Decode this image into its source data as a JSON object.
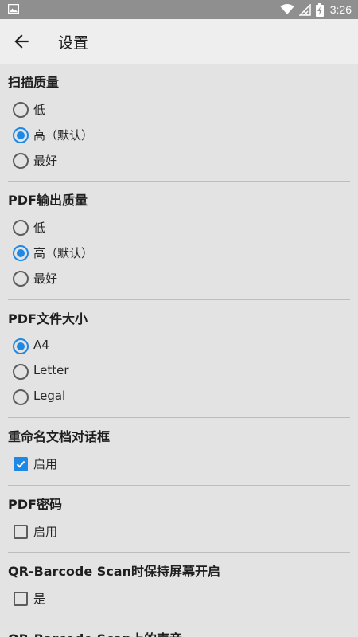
{
  "status_bar": {
    "time": "3:26",
    "icons": [
      "image-icon",
      "wifi-icon",
      "signal-icon",
      "battery-charging-icon"
    ]
  },
  "app_bar": {
    "title": "设置",
    "back_icon": "arrow-left-icon"
  },
  "sections": {
    "scan_quality": {
      "title": "扫描质量",
      "options": [
        "低",
        "高（默认）",
        "最好"
      ],
      "selected": "高（默认）"
    },
    "pdf_quality": {
      "title": "PDF输出质量",
      "options": [
        "低",
        "高（默认）",
        "最好"
      ],
      "selected": "高（默认）"
    },
    "pdf_size": {
      "title": "PDF文件大小",
      "options": [
        "A4",
        "Letter",
        "Legal"
      ],
      "selected": "A4"
    },
    "rename_dialog": {
      "title": "重命名文档对话框",
      "label": "启用",
      "checked": true
    },
    "pdf_password": {
      "title": "PDF密码",
      "label": "启用",
      "checked": false
    },
    "qr_screen_on": {
      "title": "QR-Barcode Scan时保持屏幕开启",
      "label": "是",
      "checked": false
    },
    "qr_sound": {
      "title": "QR-Barcode Scan上的声音"
    }
  },
  "colors": {
    "accent": "#1e88e5",
    "background": "#e3e3e3",
    "status_bar": "#8f8f8f"
  }
}
